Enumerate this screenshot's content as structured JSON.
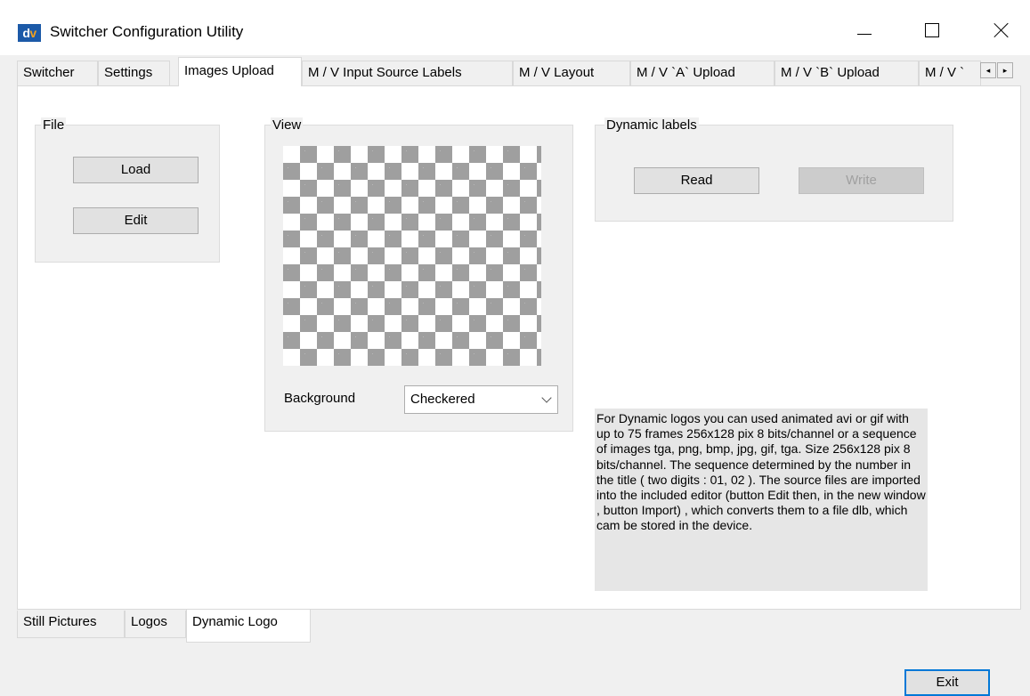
{
  "window": {
    "icon_text_d": "d",
    "icon_text_v": "v",
    "title": "Switcher Configuration Utility"
  },
  "tabs": [
    "Switcher",
    "Settings",
    "Images Upload",
    "M / V  Input Source Labels",
    "M / V Layout",
    "M / V `A` Upload",
    "M / V `B` Upload",
    "M / V `"
  ],
  "active_tab": "Images Upload",
  "tab_scroll": {
    "left": "◂",
    "right": "▸"
  },
  "file_group": {
    "title": "File",
    "load_label": "Load",
    "edit_label": "Edit"
  },
  "view_group": {
    "title": "View",
    "background_label": "Background",
    "background_value": "Checkered"
  },
  "dynamic_labels": {
    "title": "Dynamic labels",
    "read_label": "Read",
    "write_label": "Write",
    "write_enabled": false
  },
  "info_text": "For Dynamic logos you can used animated avi or gif with up to 75 frames 256x128 pix 8 bits/channel or a sequence of images tga, png, bmp, jpg, gif, tga. Size 256x128 pix 8 bits/channel. The sequence determined by the number in the title ( two digits : 01, 02 ). The source files are imported into the included editor (button Edit then, in the new window , button Import) , which converts them to a file dlb, which cam be stored in the device.",
  "bottom_tabs": [
    "Still Pictures",
    "Logos",
    "Dynamic Logo"
  ],
  "active_bottom_tab": "Dynamic Logo",
  "exit_label": "Exit",
  "colors": {
    "icon_blue": "#1c5aa8",
    "icon_orange": "#f0a020",
    "focus_border": "#0078d7",
    "checker_gray": "#9f9f9f"
  }
}
